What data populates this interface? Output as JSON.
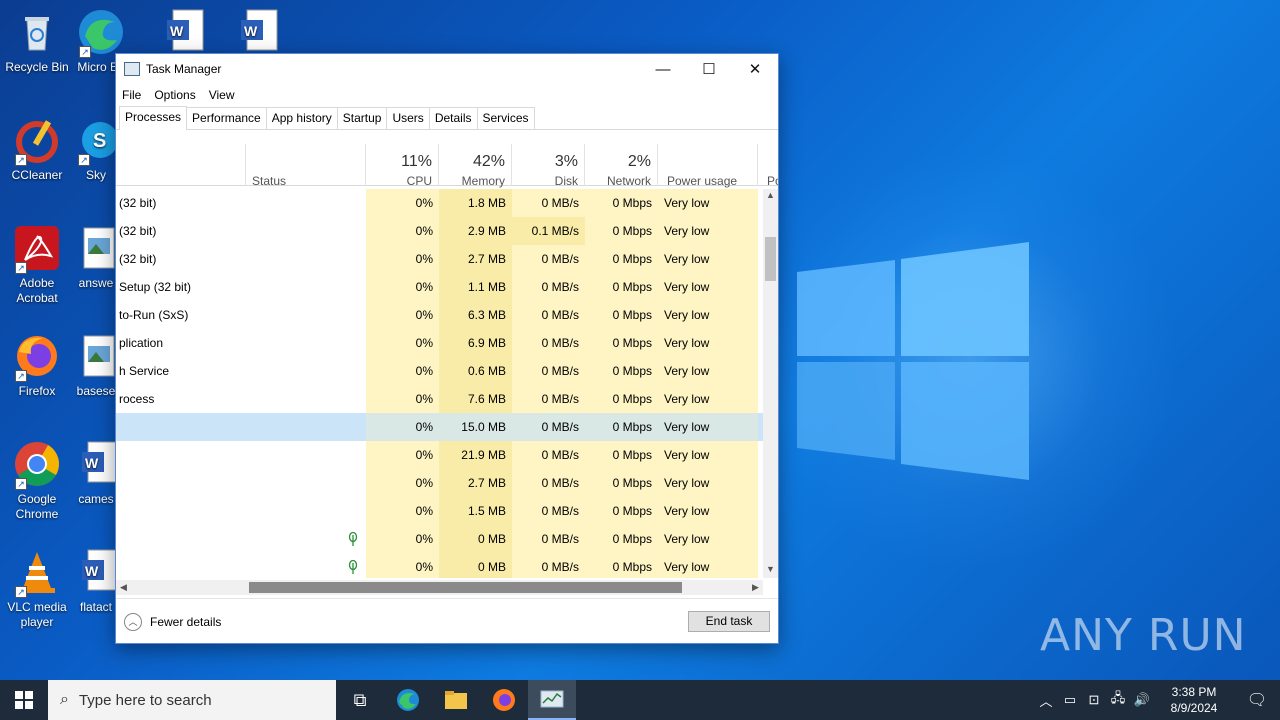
{
  "desktop": {
    "icons": [
      {
        "label": "Recycle Bin"
      },
      {
        "label": "Micro Ed"
      },
      {
        "label": "CCleaner"
      },
      {
        "label": "Sky"
      },
      {
        "label": "Adobe Acrobat"
      },
      {
        "label": "answe"
      },
      {
        "label": "Firefox"
      },
      {
        "label": "basese"
      },
      {
        "label": "Google Chrome"
      },
      {
        "label": "cames"
      },
      {
        "label": "VLC media player"
      },
      {
        "label": "flatact"
      }
    ],
    "watermark": "ANY RUN"
  },
  "taskmanager": {
    "title": "Task Manager",
    "menu": [
      "File",
      "Options",
      "View"
    ],
    "tabs": [
      "Processes",
      "Performance",
      "App history",
      "Startup",
      "Users",
      "Details",
      "Services"
    ],
    "active_tab": "Processes",
    "columns": {
      "status": "Status",
      "cpu": {
        "pct": "11%",
        "name": "CPU"
      },
      "memory": {
        "pct": "42%",
        "name": "Memory"
      },
      "disk": {
        "pct": "3%",
        "name": "Disk"
      },
      "network": {
        "pct": "2%",
        "name": "Network"
      },
      "power": "Power usage",
      "power_trend": "Po"
    },
    "rows": [
      {
        "name": "(32 bit)",
        "cpu": "0%",
        "mem": "1.8 MB",
        "disk": "0 MB/s",
        "net": "0 Mbps",
        "power": "Very low"
      },
      {
        "name": "(32 bit)",
        "cpu": "0%",
        "mem": "2.9 MB",
        "disk": "0.1 MB/s",
        "net": "0 Mbps",
        "power": "Very low"
      },
      {
        "name": "(32 bit)",
        "cpu": "0%",
        "mem": "2.7 MB",
        "disk": "0 MB/s",
        "net": "0 Mbps",
        "power": "Very low"
      },
      {
        "name": "Setup (32 bit)",
        "cpu": "0%",
        "mem": "1.1 MB",
        "disk": "0 MB/s",
        "net": "0 Mbps",
        "power": "Very low"
      },
      {
        "name": "to-Run (SxS)",
        "cpu": "0%",
        "mem": "6.3 MB",
        "disk": "0 MB/s",
        "net": "0 Mbps",
        "power": "Very low"
      },
      {
        "name": "plication",
        "cpu": "0%",
        "mem": "6.9 MB",
        "disk": "0 MB/s",
        "net": "0 Mbps",
        "power": "Very low"
      },
      {
        "name": "h Service",
        "cpu": "0%",
        "mem": "0.6 MB",
        "disk": "0 MB/s",
        "net": "0 Mbps",
        "power": "Very low"
      },
      {
        "name": "rocess",
        "cpu": "0%",
        "mem": "7.6 MB",
        "disk": "0 MB/s",
        "net": "0 Mbps",
        "power": "Very low"
      },
      {
        "name": "",
        "cpu": "0%",
        "mem": "15.0 MB",
        "disk": "0 MB/s",
        "net": "0 Mbps",
        "power": "Very low"
      },
      {
        "name": "",
        "cpu": "0%",
        "mem": "21.9 MB",
        "disk": "0 MB/s",
        "net": "0 Mbps",
        "power": "Very low"
      },
      {
        "name": "",
        "cpu": "0%",
        "mem": "2.7 MB",
        "disk": "0 MB/s",
        "net": "0 Mbps",
        "power": "Very low"
      },
      {
        "name": "",
        "cpu": "0%",
        "mem": "1.5 MB",
        "disk": "0 MB/s",
        "net": "0 Mbps",
        "power": "Very low"
      },
      {
        "name": "",
        "cpu": "0%",
        "mem": "0 MB",
        "disk": "0 MB/s",
        "net": "0 Mbps",
        "power": "Very low"
      },
      {
        "name": "",
        "cpu": "0%",
        "mem": "0 MB",
        "disk": "0 MB/s",
        "net": "0 Mbps",
        "power": "Very low"
      }
    ],
    "fewer_details": "Fewer details",
    "end_task": "End task"
  },
  "taskbar": {
    "search_placeholder": "Type here to search",
    "time": "3:38 PM",
    "date": "8/9/2024"
  }
}
